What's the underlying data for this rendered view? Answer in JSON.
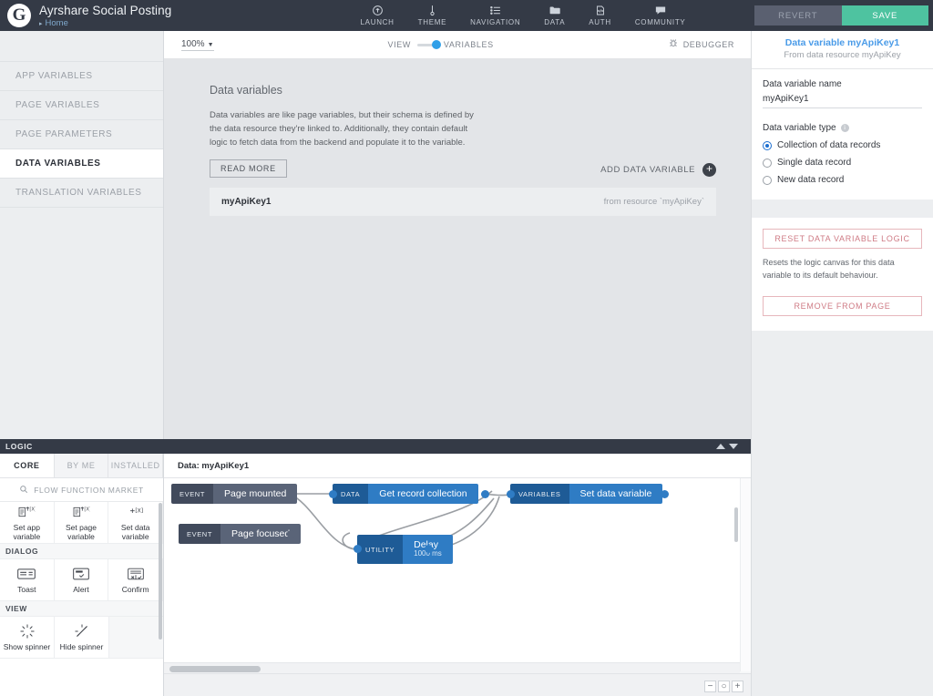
{
  "topbar": {
    "logo_glyph": "G",
    "app_title": "Ayrshare Social Posting",
    "breadcrumb": "Home",
    "nav": [
      {
        "label": "LAUNCH",
        "icon": "launch-icon"
      },
      {
        "label": "THEME",
        "icon": "theme-icon"
      },
      {
        "label": "NAVIGATION",
        "icon": "navigation-icon"
      },
      {
        "label": "DATA",
        "icon": "data-icon"
      },
      {
        "label": "AUTH",
        "icon": "auth-icon"
      },
      {
        "label": "COMMUNITY",
        "icon": "community-icon"
      }
    ],
    "revert_label": "REVERT",
    "save_label": "SAVE",
    "save_color": "#4ec3a0"
  },
  "sidebar": {
    "items": [
      {
        "label": "APP VARIABLES",
        "active": false
      },
      {
        "label": "PAGE VARIABLES",
        "active": false
      },
      {
        "label": "PAGE PARAMETERS",
        "active": false
      },
      {
        "label": "DATA VARIABLES",
        "active": true
      },
      {
        "label": "TRANSLATION VARIABLES",
        "active": false
      }
    ]
  },
  "toolbar": {
    "zoom_level": "100%",
    "view_label": "VIEW",
    "view_mode": "VARIABLES",
    "toggle_color": "#2f9fe8",
    "debugger_label": "DEBUGGER"
  },
  "main": {
    "panel_title": "Data variables",
    "panel_description": "Data variables are like page variables, but their schema is defined by the data resource they're linked to. Additionally, they contain default logic to fetch data from the backend and populate it to the variable.",
    "read_more_label": "READ MORE",
    "add_variable_label": "ADD DATA VARIABLE",
    "variables": [
      {
        "name": "myApiKey1",
        "source": "from resource `myApiKey`"
      }
    ]
  },
  "inspector": {
    "title": "Data variable myApiKey1",
    "subtitle": "From data resource myApiKey",
    "name_label": "Data variable name",
    "name_value": "myApiKey1",
    "type_label": "Data variable type",
    "type_options": [
      {
        "label": "Collection of data records",
        "selected": true
      },
      {
        "label": "Single data record",
        "selected": false
      },
      {
        "label": "New data record",
        "selected": false
      }
    ],
    "reset_label": "RESET DATA VARIABLE LOGIC",
    "reset_note": "Resets the logic canvas for this data variable to its default behaviour.",
    "remove_label": "REMOVE FROM PAGE",
    "danger_color": "#cf7b85"
  },
  "logic": {
    "header_label": "LOGIC",
    "tabs": [
      {
        "label": "CORE",
        "active": true
      },
      {
        "label": "BY ME",
        "active": false
      },
      {
        "label": "INSTALLED",
        "active": false
      }
    ],
    "search_label": "FLOW FUNCTION MARKET",
    "groups": [
      {
        "name": "",
        "items": [
          {
            "label": "Set app variable",
            "icon": "set-app-variable-icon"
          },
          {
            "label": "Set page variable",
            "icon": "set-page-variable-icon"
          },
          {
            "label": "Set data variable",
            "icon": "set-data-variable-icon"
          }
        ]
      },
      {
        "name": "DIALOG",
        "items": [
          {
            "label": "Toast",
            "icon": "toast-icon"
          },
          {
            "label": "Alert",
            "icon": "alert-icon"
          },
          {
            "label": "Confirm",
            "icon": "confirm-icon"
          }
        ]
      },
      {
        "name": "VIEW",
        "items": [
          {
            "label": "Show spinner",
            "icon": "show-spinner-icon"
          },
          {
            "label": "Hide spinner",
            "icon": "hide-spinner-icon"
          }
        ]
      }
    ]
  },
  "flow": {
    "title": "Data: myApiKey1",
    "nodes": [
      {
        "id": "page-mounted",
        "category": "EVENT",
        "title": "Page mounted",
        "subtitle": "",
        "kind": "event"
      },
      {
        "id": "page-focused",
        "category": "EVENT",
        "title": "Page focused",
        "subtitle": "",
        "kind": "event"
      },
      {
        "id": "get-record-collection",
        "category": "DATA",
        "title": "Get record collection",
        "subtitle": "",
        "kind": "data"
      },
      {
        "id": "set-data-variable",
        "category": "VARIABLES",
        "title": "Set data variable",
        "subtitle": "",
        "kind": "vars"
      },
      {
        "id": "delay",
        "category": "UTILITY",
        "title": "Delay",
        "subtitle": "1000 ms",
        "kind": "util"
      }
    ],
    "zoom_out_label": "−",
    "zoom_reset_label": "○",
    "zoom_in_label": "+"
  }
}
